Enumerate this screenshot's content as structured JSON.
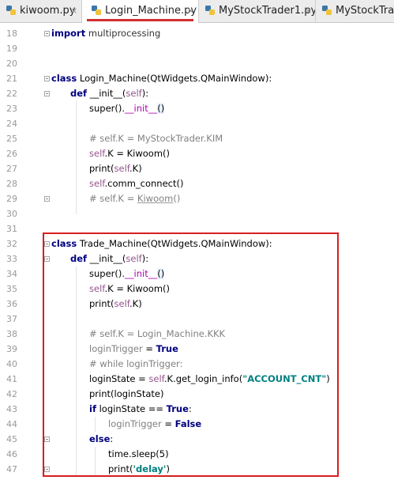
{
  "tabs": [
    {
      "label": "kiwoom.py",
      "active": false
    },
    {
      "label": "Login_Machine.py",
      "active": true
    },
    {
      "label": "MyStockTrader1.py",
      "active": false
    },
    {
      "label": "MyStockTrader.py",
      "active": false
    }
  ],
  "close_glyph": "×",
  "line_numbers": [
    "18",
    "19",
    "20",
    "21",
    "22",
    "23",
    "24",
    "25",
    "26",
    "27",
    "28",
    "29",
    "30",
    "31",
    "32",
    "33",
    "34",
    "35",
    "36",
    "37",
    "38",
    "39",
    "40",
    "41",
    "42",
    "43",
    "44",
    "45",
    "46",
    "47"
  ],
  "code": {
    "l18": {
      "kw": "import",
      "rest": " multiprocessing"
    },
    "l21": {
      "kw": "class",
      "rest": " Login_Machine(QtWidgets.QMainWindow):"
    },
    "l22": {
      "kw": "def",
      "name": " __init__(",
      "self": "self",
      "end": "):"
    },
    "l23": {
      "a": "super().",
      "magic": "__init__",
      "b": "()"
    },
    "l25": {
      "comment": "# self.K = MyStockTrader.KIM"
    },
    "l26": {
      "self": "self",
      "rest": ".K = Kiwoom()"
    },
    "l27": {
      "a": "print(",
      "self": "self",
      "b": ".K)"
    },
    "l28": {
      "self": "self",
      "rest": ".comm_connect()"
    },
    "l29": {
      "comment": "# self.K = ",
      "ul": "Kiwoom",
      "tail": "()"
    },
    "l32": {
      "kw": "class",
      "rest": " Trade_Machine(QtWidgets.QMainWindow):"
    },
    "l33": {
      "kw": "def",
      "name": " __init__(",
      "self": "self",
      "end": "):"
    },
    "l34": {
      "a": "super().",
      "magic": "__init__",
      "b": "()"
    },
    "l35": {
      "self": "self",
      "rest": ".K = Kiwoom()"
    },
    "l36": {
      "a": "print(",
      "self": "self",
      "b": ".K)"
    },
    "l38": {
      "comment": "# self.K = Login_Machine.KKK"
    },
    "l39": {
      "var": "loginTrigger",
      "mid": " = ",
      "kw": "True"
    },
    "l40": {
      "comment": "# while loginTrigger:"
    },
    "l41": {
      "a": "loginState = ",
      "self": "self",
      "b": ".K.get_login_info(",
      "str": "\"ACCOUNT_CNT\"",
      "c": ")"
    },
    "l42": {
      "text": "print(loginState)"
    },
    "l43": {
      "kw": "if",
      "mid": " loginState == ",
      "kw2": "True",
      "end": ":"
    },
    "l44": {
      "var": "loginTrigger",
      "mid": " = ",
      "kw": "False"
    },
    "l45": {
      "kw": "else",
      "end": ":"
    },
    "l46": {
      "text": "time.sleep(5)"
    },
    "l47": {
      "a": "print(",
      "str": "'delay'",
      "b": ")"
    }
  }
}
